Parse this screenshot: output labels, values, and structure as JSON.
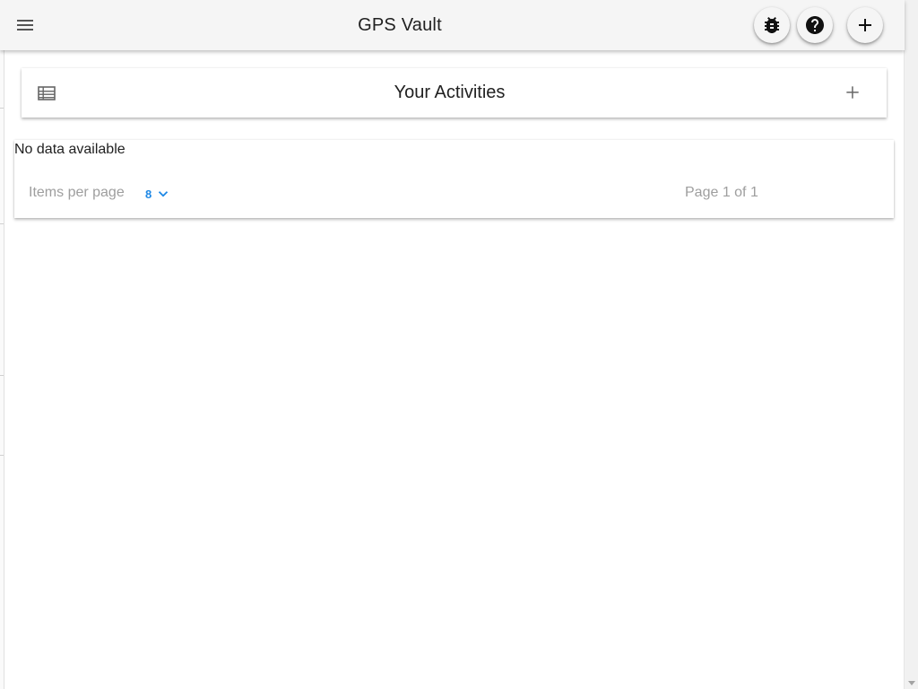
{
  "app": {
    "title": "GPS Vault"
  },
  "toolbar": {
    "menu_icon": "menu-icon",
    "bug_icon": "bug-icon",
    "help_icon": "help-icon",
    "add_icon": "plus-icon"
  },
  "activities": {
    "header_icon": "list-icon",
    "title": "Your Activities",
    "add_icon": "plus-icon"
  },
  "table": {
    "empty_message": "No data available",
    "items_per_page_label": "Items per page",
    "items_per_page_value": "8",
    "page_info": "Page 1 of 1"
  },
  "colors": {
    "app_bar": "#f5f5f5",
    "accent": "#1e88e5",
    "muted_text": "#9e9e9e"
  }
}
